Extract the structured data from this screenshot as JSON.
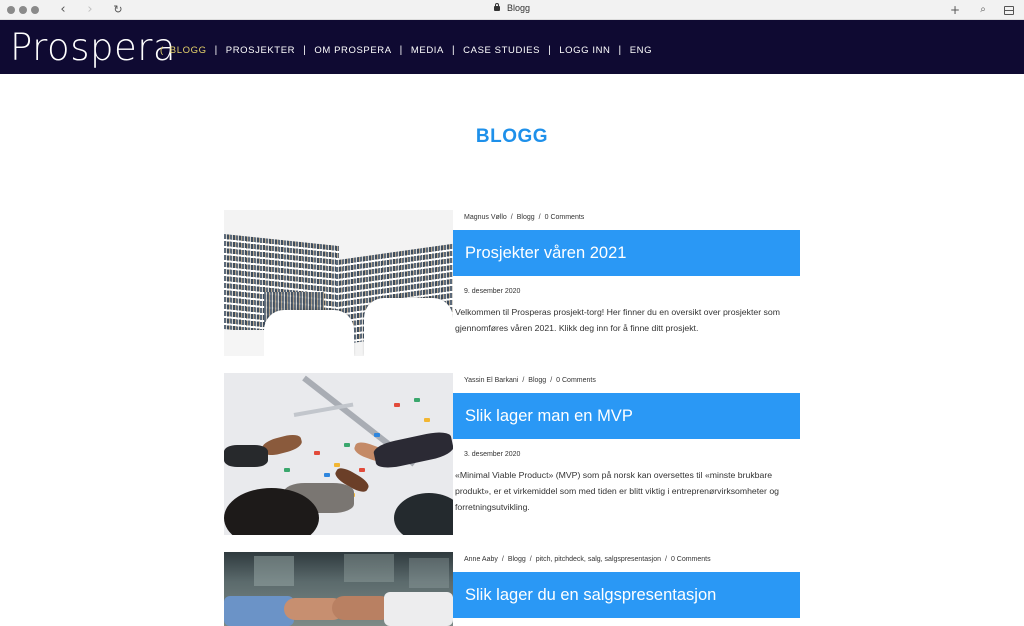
{
  "browser": {
    "address": "Blogg"
  },
  "site": {
    "logo": "Prospera",
    "menu": [
      {
        "label": "BLOGG",
        "active": true
      },
      {
        "label": "PROSJEKTER"
      },
      {
        "label": "OM PROSPERA"
      },
      {
        "label": "MEDIA"
      },
      {
        "label": "CASE STUDIES"
      },
      {
        "label": "LOGG INN"
      },
      {
        "label": "ENG"
      }
    ]
  },
  "page": {
    "title": "BLOGG"
  },
  "posts": [
    {
      "author": "Magnus Vøllo",
      "categories": "Blogg",
      "comments": "0 Comments",
      "title": "Prosjekter våren 2021",
      "date": "9. desember 2020",
      "excerpt": "Velkommen til Prosperas prosjekt-torg! Her finner du en oversikt over prosjekter som gjennomføres våren 2021. Klikk deg inn for å finne ditt prosjekt."
    },
    {
      "author": "Yassin El Barkani",
      "categories": "Blogg",
      "comments": "0 Comments",
      "title": "Slik lager man en MVP",
      "date": "3. desember 2020",
      "excerpt": "«Minimal Viable Product» (MVP) som på norsk kan oversettes til «minste brukbare produkt», er et virkemiddel som med tiden er blitt viktig i entreprenørvirksomheter og forretningsutvikling."
    },
    {
      "author": "Anne Aaby",
      "categories": "Blogg",
      "tags": "pitch, pitchdeck, salg, salgspresentasjon",
      "comments": "0 Comments",
      "title": "Slik lager du en salgspresentasjon"
    }
  ]
}
